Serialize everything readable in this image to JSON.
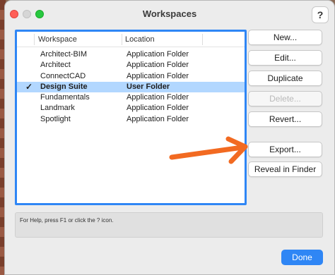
{
  "window": {
    "title": "Workspaces",
    "help_label": "?"
  },
  "list": {
    "columns": [
      "Workspace",
      "Location"
    ],
    "rows": [
      {
        "name": "Architect-BIM",
        "location": "Application Folder",
        "checked": false,
        "selected": false
      },
      {
        "name": "Architect",
        "location": "Application Folder",
        "checked": false,
        "selected": false
      },
      {
        "name": "ConnectCAD",
        "location": "Application Folder",
        "checked": false,
        "selected": false
      },
      {
        "name": "Design Suite",
        "location": "User Folder",
        "checked": true,
        "selected": true
      },
      {
        "name": "Fundamentals",
        "location": "Application Folder",
        "checked": false,
        "selected": false
      },
      {
        "name": "Landmark",
        "location": "Application Folder",
        "checked": false,
        "selected": false
      },
      {
        "name": "Spotlight",
        "location": "Application Folder",
        "checked": false,
        "selected": false
      }
    ]
  },
  "buttons": {
    "new": "New...",
    "edit": "Edit...",
    "duplicate": "Duplicate",
    "delete": "Delete...",
    "revert": "Revert...",
    "export": "Export...",
    "reveal": "Reveal in Finder",
    "done": "Done"
  },
  "status": {
    "text": "For Help, press F1 or click the ? icon."
  },
  "colors": {
    "selection": "#b2d7ff",
    "accent": "#2f86f5",
    "annotation_arrow": "#f26a21"
  },
  "icons": {
    "check": "✓",
    "annotation": "arrow-right-icon"
  }
}
